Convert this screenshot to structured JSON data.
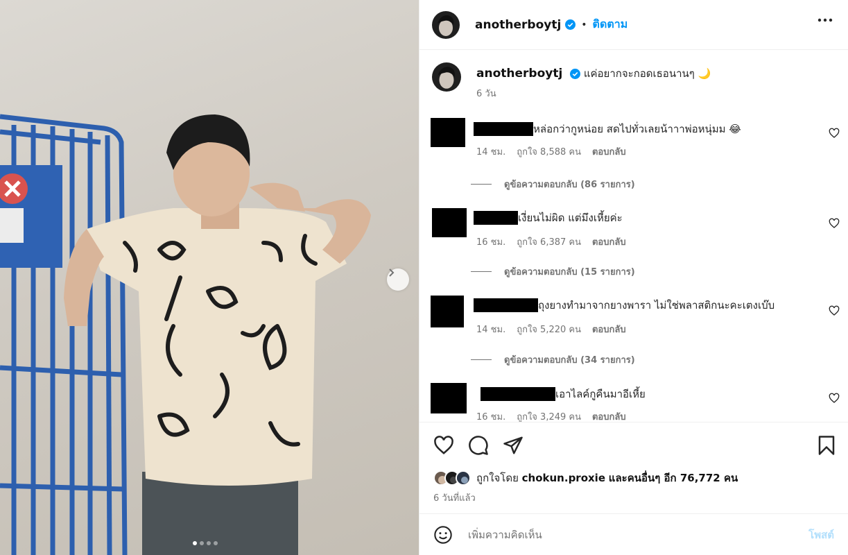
{
  "post": {
    "username": "anotherboytj",
    "follow_label": "ติดตาม",
    "caption": "แค่อยากจะกอดเธอนานๆ 🌙",
    "caption_time": "6 วัน",
    "likes_prefix": "ถูกใจโดย",
    "likes_user": "chokun.proxie",
    "likes_suffix": "และคนอื่นๆ อีก 76,772 คน",
    "post_date": "6 วันที่แล้ว",
    "add_comment_placeholder": "เพิ่มความคิดเห็น",
    "post_label": "โพสต์",
    "carousel_slides": 4,
    "carousel_active": 1
  },
  "comments": [
    {
      "text": "หล่อกว่ากูหน่อย สดไปทั่วเลยน้าาาพ่อหนุ่มม 😂",
      "time": "14 ชม.",
      "likes": "ถูกใจ 8,588 คน",
      "reply": "ตอบกลับ",
      "view_replies": "ดูข้อความตอบกลับ (86 รายการ)"
    },
    {
      "text": "เงี่ยนไม่ผิด แต่มึงเหี้ยค่ะ",
      "time": "16 ชม.",
      "likes": "ถูกใจ 6,387 คน",
      "reply": "ตอบกลับ",
      "view_replies": "ดูข้อความตอบกลับ (15 รายการ)"
    },
    {
      "text": "ถุงยางทำมาจากยางพารา ไม่ใช่พลาสติกนะคะเตงเบ๊บ",
      "time": "14 ชม.",
      "likes": "ถูกใจ 5,220 คน",
      "reply": "ตอบกลับ",
      "view_replies": "ดูข้อความตอบกลับ (34 รายการ)"
    },
    {
      "text": "เอาไลค์กูคืนมาอีเหี้ย",
      "time": "16 ชม.",
      "likes": "ถูกใจ 3,249 คน",
      "reply": "ตอบกลับ"
    }
  ],
  "colors": {
    "accent": "#0095f6",
    "verified": "#0095f6",
    "muted": "#737373",
    "post_disabled": "#b2dffc"
  },
  "icons": [
    "more-icon",
    "verified-icon",
    "heart-icon",
    "comment-icon",
    "share-icon",
    "bookmark-icon",
    "emoji-icon",
    "chevron-right-icon"
  ]
}
